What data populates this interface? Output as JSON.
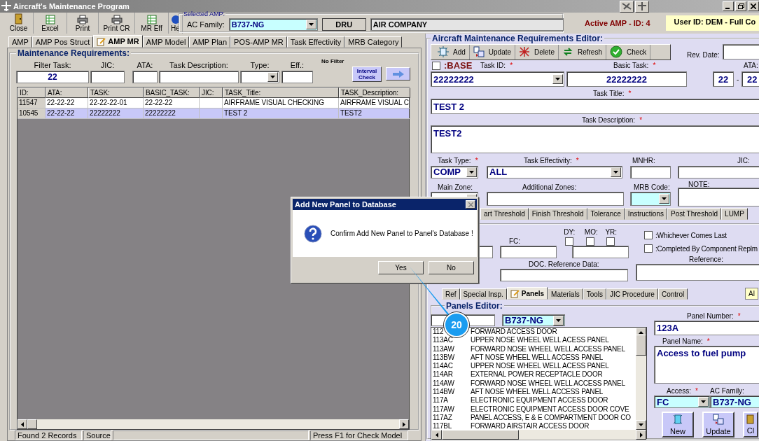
{
  "window": {
    "title": "Aircraft's Maintenance Program"
  },
  "toolbar": [
    {
      "label": "Close",
      "kind": "close"
    },
    {
      "label": "Excel",
      "kind": "excel"
    },
    {
      "label": "Print",
      "kind": "print"
    },
    {
      "label": "Print CR",
      "kind": "print"
    },
    {
      "label": "MR Eff",
      "kind": "excel"
    },
    {
      "label": "He",
      "kind": "help"
    }
  ],
  "selected_amp": {
    "legend": "Selected AMP:",
    "ac_family_label": "AC Family:",
    "ac_family": "B737-NG",
    "code": "DRU",
    "company": "AIR COMPANY"
  },
  "active_amp": "Active AMP - ID: 4",
  "user": "User ID: DEM - Full Co",
  "tabs": [
    {
      "label": "AMP",
      "selected": false
    },
    {
      "label": "AMP Pos Struct",
      "selected": false
    },
    {
      "label": "AMP MR",
      "selected": true
    },
    {
      "label": "AMP Model",
      "selected": false
    },
    {
      "label": "AMP Plan",
      "selected": false
    },
    {
      "label": "POS-AMP MR",
      "selected": false
    },
    {
      "label": "Task Effectivity",
      "selected": false
    },
    {
      "label": "MRB Category",
      "selected": false
    }
  ],
  "maintenance": {
    "legend": "Maintenance Requirements:",
    "filters": [
      {
        "label": "Filter Task:",
        "kind": "text",
        "value": "22"
      },
      {
        "label": "JIC:",
        "kind": "text"
      },
      {
        "label": "ATA:",
        "kind": "text"
      },
      {
        "label": "Task Description:",
        "kind": "text"
      },
      {
        "label": "Type:",
        "kind": "combo"
      },
      {
        "label": "Eff.:",
        "kind": "text"
      }
    ],
    "filter_status": "No Filter",
    "interval_button": "Interval Check",
    "columns": [
      "ID:",
      "ATA:",
      "TASK:",
      "BASIC_TASK:",
      "JIC:",
      "TASK_Title:",
      "TASK_Description:"
    ],
    "rows": [
      {
        "id": "11547",
        "ata": "22-22-22",
        "task": "22-22-22-01",
        "basic_task": "22-22-22",
        "task_title": "AIRFRAME VISUAL CHECKING",
        "task_description": "AIRFRAME VISUAL C",
        "selected": false
      },
      {
        "id": "10545",
        "ata": "22-22-22",
        "task": "22222222",
        "basic_task": "22222222",
        "task_title": "TEST 2",
        "task_description": "TEST2",
        "selected": true
      }
    ]
  },
  "status_bar": [
    "Found 2 Records",
    "Source",
    "Press F1 for Check Model"
  ],
  "editor": {
    "legend": "Aircraft Maintenance Requirements Editor:",
    "actions": [
      {
        "label": "Add",
        "kind": "add"
      },
      {
        "label": "Update",
        "kind": "update"
      },
      {
        "label": "Delete",
        "kind": "delete"
      },
      {
        "label": "Refresh",
        "kind": "refresh"
      },
      {
        "label": "Check",
        "kind": "check"
      }
    ],
    "rev_date_label": "Rev. Date:",
    "base": {
      "label": ":BASE",
      "checked": false
    },
    "task_id": {
      "label": "Task ID:",
      "required_mark": "*",
      "value": "22222222"
    },
    "basic_task": {
      "label": "Basic Task:",
      "required_mark": "*",
      "value": "22222222"
    },
    "ata": {
      "label": "ATA:",
      "parts": [
        "22",
        "22"
      ],
      "separator": "-"
    },
    "task_title": {
      "label": "Task Title:",
      "required_mark": "*",
      "value": "TEST 2"
    },
    "task_description": {
      "label": "Task Description:",
      "required_mark": "*",
      "value": "TEST2"
    },
    "task_type": {
      "label": "Task Type:",
      "required_mark": "*",
      "value": "COMP"
    },
    "task_effectivity": {
      "label": "Task Effectivity:",
      "required_mark": "*",
      "value": "ALL"
    },
    "mnhr_label": "MNHR:",
    "jic_label": "JIC:",
    "main_zone_label": "Main Zone:",
    "additional_zones_label": "Additional Zones:",
    "mrb_code_label": "MRB Code:",
    "note_label": "NOTE:",
    "threshold_tabs": [
      {
        "label": "art Threshold",
        "selected": false
      },
      {
        "label": "Finish Threshold",
        "selected": false
      },
      {
        "label": "Tolerance",
        "selected": false
      },
      {
        "label": "Instructions",
        "selected": false
      },
      {
        "label": "Post Threshold",
        "selected": false
      },
      {
        "label": "LUMP",
        "selected": false
      }
    ],
    "interval": {
      "units": [
        {
          "label": "DY:",
          "checked": false
        },
        {
          "label": "MO:",
          "checked": false
        },
        {
          "label": "YR:",
          "checked": false
        }
      ],
      "fc_label": "FC:",
      "doc_label": "DOC. Reference Data:",
      "reference_label": "Reference:",
      "options": [
        {
          "label": ":Whichever Comes Last",
          "checked": false
        },
        {
          "label": ":Completed By Component Replm",
          "checked": false
        }
      ]
    },
    "detail_tabs": [
      {
        "label": "Ref",
        "selected": false
      },
      {
        "label": "Special Insp.",
        "selected": false
      },
      {
        "label": "Panels",
        "selected": true
      },
      {
        "label": "Materials",
        "selected": false
      },
      {
        "label": "Tools",
        "selected": false
      },
      {
        "label": "JIC Procedure",
        "selected": false
      },
      {
        "label": "Control",
        "selected": false
      }
    ],
    "detail_badge": "Al",
    "panels": {
      "legend": "Panels Editor:",
      "family": "B737-NG",
      "list": [
        {
          "code": "112",
          "name": "FORWARD ACCESS DOOR"
        },
        {
          "code": "113AC",
          "name": "UPPER NOSE WHEEL WELL ACESS PANEL"
        },
        {
          "code": "113AW",
          "name": "FORWARD NOSE WHEEL WELL ACCESS PANEL"
        },
        {
          "code": "113BW",
          "name": "AFT NOSE WHEEL WELL ACCESS PANEL"
        },
        {
          "code": "114AC",
          "name": "UPPER NOSE WHEEL WELL ACESS PANEL"
        },
        {
          "code": "114AR",
          "name": "EXTERNAL POWER RECEPTACLE DOOR"
        },
        {
          "code": "114AW",
          "name": "FORWARD NOSE WHEEL WELL ACCESS PANEL"
        },
        {
          "code": "114BW",
          "name": "AFT NOSE WHEEL WELL ACCESS PANEL"
        },
        {
          "code": "117A",
          "name": "ELECTRONIC EQUIPMENT ACCESS DOOR"
        },
        {
          "code": "117AW",
          "name": "ELECTRONIC EQUIPMENT ACCESS DOOR COVE"
        },
        {
          "code": "117AZ",
          "name": "PANEL ACCESS, E & E COMPARTMENT DOOR CO"
        },
        {
          "code": "117BL",
          "name": "FORWARD AIRSTAIR ACCESS DOOR"
        }
      ],
      "panel_number": {
        "label": "Panel Number:",
        "required_mark": "*",
        "value": "123A"
      },
      "panel_name": {
        "label": "Panel Name:",
        "required_mark": "*",
        "value": "Access to fuel pump"
      },
      "access": {
        "label": "Access:",
        "required_mark": "*",
        "value": "FC"
      },
      "ac_family": {
        "label": "AC Family:",
        "value": "B737-NG"
      },
      "buttons": [
        {
          "label": "New",
          "kind": "new"
        },
        {
          "label": "Update",
          "kind": "update"
        },
        {
          "label": "Cl",
          "kind": "close"
        }
      ]
    }
  },
  "dialog": {
    "title": "Add New Panel to Database",
    "message": "Confirm Add New Panel to Panel's Database !",
    "buttons": [
      "Yes",
      "No"
    ]
  },
  "callout": {
    "number": "20"
  }
}
